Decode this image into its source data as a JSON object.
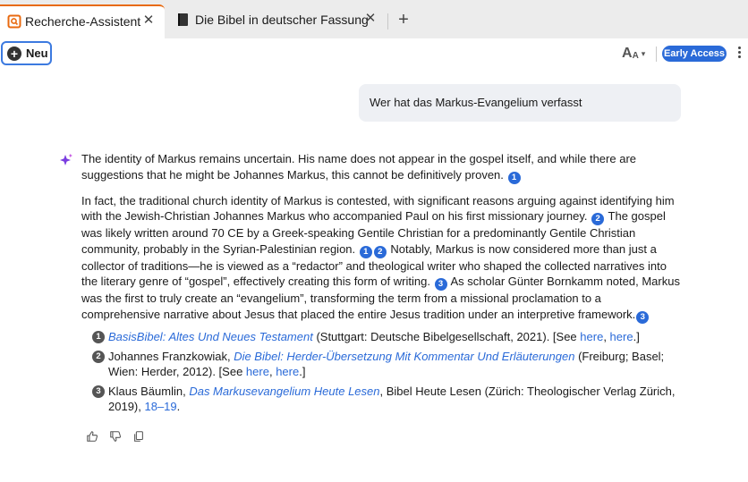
{
  "tabs": [
    {
      "label": "Recherche-Assistent",
      "close": "✕"
    },
    {
      "label": "Die Bibel in deutscher Fassung",
      "close": "✕"
    }
  ],
  "new_tab_label": "+",
  "toolbar": {
    "new_label": "Neu",
    "font_size_big": "A",
    "font_size_small": "A",
    "early_access": "Early Access"
  },
  "user_message": "Wer hat das Markus-Evangelium verfasst",
  "answer": {
    "p1": {
      "text": "The identity of Markus remains uncertain. His name does not appear in the gospel itself, and while there are suggestions that he might be Johannes Markus, this cannot be definitively proven.",
      "cite": "1"
    },
    "p2": {
      "s1": "In fact, the traditional church identity of Markus is contested, with significant reasons arguing against identifying him with the Jewish-Christian Johannes Markus who accompanied Paul on his first missionary journey.",
      "c1": "2",
      "s2": " The gospel was likely written around 70 CE by a Greek-speaking Gentile Christian for a predominantly Gentile Christian community, probably in the Syrian-Palestinian region.",
      "c2a": "1",
      "c2b": "2",
      "s3": " Notably, Markus is now considered more than just a collector of traditions—he is viewed as a “redactor” and theological writer who shaped the collected narratives into the literary genre of “gospel”, effectively creating this form of writing.",
      "c3": "3",
      "s4": " As scholar Günter Bornkamm noted, Markus was the first to truly create an “evangelium”, transforming the term from a missional proclamation to a comprehensive narrative about Jesus that placed the entire Jesus tradition under an interpretive framework.",
      "c4": "3"
    }
  },
  "references": [
    {
      "num": "1",
      "title": "BasisBibel: Altes Und Neues Testament",
      "rest": " (Stuttgart: Deutsche Bibelgesellschaft, 2021). [See ",
      "link1": "here",
      "sep": ", ",
      "link2": "here",
      "end": ".]"
    },
    {
      "num": "2",
      "author": "Johannes Franzkowiak, ",
      "title": "Die Bibel: Herder-Übersetzung Mit Kommentar Und Erläuterungen",
      "rest": " (Freiburg; Basel; Wien: Herder, 2012). [See ",
      "link1": "here",
      "sep": ", ",
      "link2": "here",
      "end": ".]"
    },
    {
      "num": "3",
      "author": "Klaus Bäumlin, ",
      "title": "Das Markusevangelium Heute Lesen",
      "rest": ", Bibel Heute Lesen (Zürich: Theologischer Verlag Zürich, 2019), ",
      "pages": "18–19",
      "end": "."
    }
  ],
  "icons": {
    "tab1": "chat-book-icon",
    "tab2": "bible-book-icon",
    "answer": "sparkle-icon",
    "feedback": [
      "thumbs-up-icon",
      "thumbs-down-icon",
      "copy-icon"
    ]
  },
  "colors": {
    "accent_tab": "#e86a10",
    "link": "#2a6ad8",
    "citation_badge": "#2a6ad8",
    "reference_badge": "#555555",
    "sparkle": "#7a3de0"
  }
}
